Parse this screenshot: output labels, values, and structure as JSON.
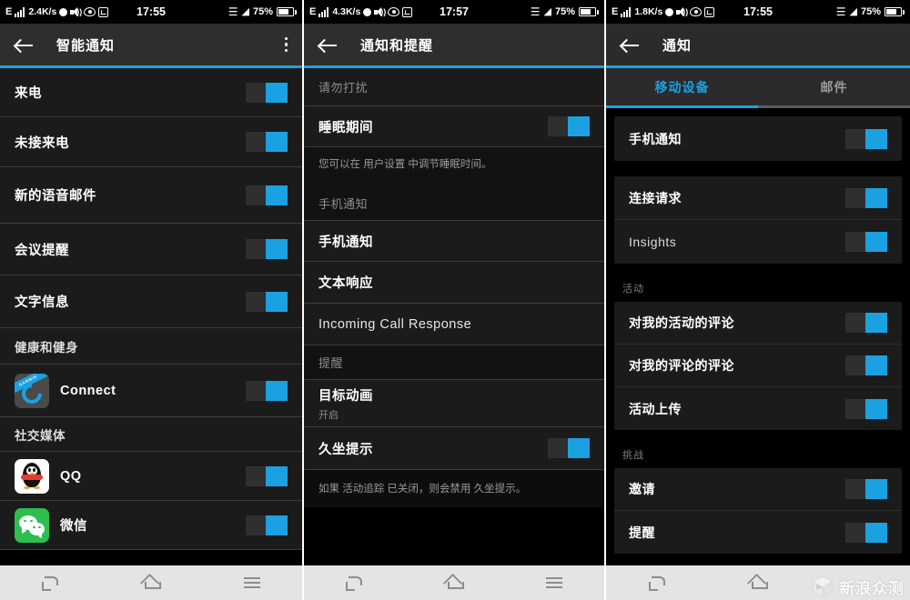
{
  "panels": [
    {
      "status": {
        "network": "E",
        "rate": "2.4K/s",
        "time": "17:55",
        "battery": "75%",
        "icons": [
          "signal-bars",
          "dot",
          "speaker-mute",
          "eye",
          "alarm",
          "bluetooth",
          "wifi",
          "battery"
        ]
      },
      "actionbar": {
        "title": "智能通知",
        "back": "back-arrow",
        "overflow": "overflow-menu"
      },
      "rows": [
        {
          "type": "toggle",
          "label": "来电",
          "on": true
        },
        {
          "type": "toggle",
          "label": "未接来电",
          "on": true
        },
        {
          "type": "toggle",
          "label": "新的语音邮件",
          "on": true
        },
        {
          "type": "toggle",
          "label": "会议提醒",
          "on": true
        },
        {
          "type": "toggle",
          "label": "文字信息",
          "on": true
        },
        {
          "type": "section",
          "label": "健康和健身"
        },
        {
          "type": "app",
          "label": "Connect",
          "icon": "garmin-connect-icon",
          "on": true
        },
        {
          "type": "section",
          "label": "社交媒体"
        },
        {
          "type": "app",
          "label": "QQ",
          "icon": "qq-icon",
          "on": true
        },
        {
          "type": "app",
          "label": "微信",
          "icon": "wechat-icon",
          "on": true
        }
      ]
    },
    {
      "status": {
        "network": "E",
        "rate": "4.3K/s",
        "time": "17:57",
        "battery": "75%"
      },
      "actionbar": {
        "title": "通知和提醒",
        "back": "back-arrow"
      },
      "rows": [
        {
          "type": "section-faint",
          "label": "请勿打扰"
        },
        {
          "type": "toggle",
          "label": "睡眠期间",
          "on": true
        },
        {
          "type": "help",
          "label": "您可以在 用户设置 中调节睡眠时间。"
        },
        {
          "type": "section-faint",
          "label": "手机通知"
        },
        {
          "type": "plain",
          "label": "手机通知"
        },
        {
          "type": "plain",
          "label": "文本响应"
        },
        {
          "type": "plain-en",
          "label": "Incoming Call Response"
        },
        {
          "type": "section-faint",
          "label": "提醒"
        },
        {
          "type": "plain-sub",
          "label": "目标动画",
          "sub": "开启"
        },
        {
          "type": "toggle",
          "label": "久坐提示",
          "on": true
        },
        {
          "type": "help",
          "label": "如果 活动追踪 已关闭，则会禁用 久坐提示。"
        }
      ]
    },
    {
      "status": {
        "network": "E",
        "rate": "1.8K/s",
        "time": "17:55",
        "battery": "75%"
      },
      "actionbar": {
        "title": "通知",
        "back": "back-arrow"
      },
      "tabs": [
        {
          "label": "移动设备",
          "active": true
        },
        {
          "label": "邮件",
          "active": false
        }
      ],
      "groups": [
        {
          "header": null,
          "rows": [
            {
              "label": "手机通知",
              "on": true
            }
          ]
        },
        {
          "header": null,
          "rows": [
            {
              "label": "连接请求",
              "on": true
            },
            {
              "label": "Insights",
              "on": true,
              "english": true
            }
          ]
        },
        {
          "header": "活动",
          "rows": [
            {
              "label": "对我的活动的评论",
              "on": true
            },
            {
              "label": "对我的评论的评论",
              "on": true
            },
            {
              "label": "活动上传",
              "on": true
            }
          ]
        },
        {
          "header": "挑战",
          "rows": [
            {
              "label": "邀请",
              "on": true
            },
            {
              "label": "提醒",
              "on": true,
              "clipped": true
            }
          ]
        }
      ]
    }
  ],
  "navbar": {
    "back": "back-button",
    "home": "home-button",
    "menu": "menu-button"
  },
  "watermark": {
    "text": "新浪众测",
    "icon": "cube-logo"
  },
  "colors": {
    "accent": "#1ba1e2",
    "actionbar": "#2e2e2e",
    "row_bg": "#1b1b1b",
    "page_bg": "#000000",
    "navbar_bg": "#e4e4e4"
  }
}
